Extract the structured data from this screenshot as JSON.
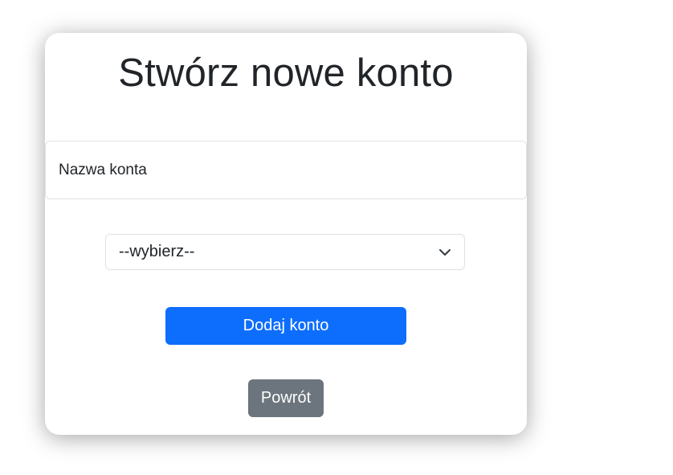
{
  "form": {
    "title": "Stwórz nowe konto",
    "account_name_placeholder": "Nazwa konta",
    "account_name_value": "",
    "account_type_selected": "--wybierz--",
    "submit_label": "Dodaj konto",
    "back_label": "Powrót"
  },
  "icons": {
    "select_toggle": "chevron-down-icon"
  },
  "colors": {
    "primary": "#0d6efd",
    "secondary": "#6c757d",
    "text": "#212529",
    "border": "#dee2e6"
  }
}
